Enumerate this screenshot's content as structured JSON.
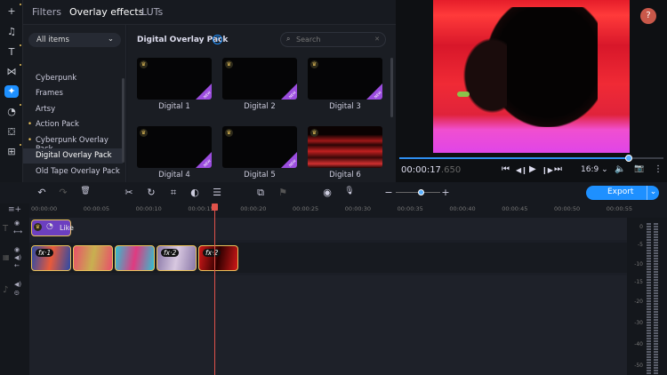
{
  "rail": {
    "icons": [
      "plus-icon",
      "music-icon",
      "text-icon",
      "transitions-icon",
      "effects-icon",
      "stickers-icon",
      "shop-icon",
      "more-apps-icon"
    ]
  },
  "tabs": [
    {
      "label": "Filters"
    },
    {
      "label": "Overlay effects",
      "active": true
    },
    {
      "label": "LUTs"
    }
  ],
  "category_select": {
    "value": "All items"
  },
  "categories": [
    {
      "label": "Cyberpunk"
    },
    {
      "label": "Frames"
    },
    {
      "label": "Artsy"
    },
    {
      "label": "Action Pack",
      "premium": true
    },
    {
      "label": "Cyberpunk Overlay Pack",
      "premium": true
    },
    {
      "label": "Digital Overlay Pack",
      "selected": true
    },
    {
      "label": "Old Tape Overlay Pack"
    }
  ],
  "pack": {
    "title": "Digital Overlay Pack",
    "help": "?",
    "search_placeholder": "Search",
    "clear": "✕"
  },
  "effects": [
    {
      "name": "Digital 1",
      "new": true
    },
    {
      "name": "Digital 2",
      "new": true
    },
    {
      "name": "Digital 3",
      "new": true
    },
    {
      "name": "Digital 4",
      "new": true
    },
    {
      "name": "Digital 5",
      "new": true
    },
    {
      "name": "Digital 6",
      "new": false
    }
  ],
  "badge_new": "NEW",
  "preview": {
    "help": "?",
    "time_main": "00:00:17",
    "time_ms": ".650",
    "progress": 0.87,
    "aspect": "16:9 ⌄"
  },
  "player": {
    "prev": "⏮",
    "step_back": "◀❙",
    "play": "▶",
    "step_fwd": "❙▶",
    "next": "⏭",
    "volume": "🔈",
    "snapshot": "📷",
    "more": "⋮"
  },
  "toolbar": {
    "undo": "↶",
    "redo": "↷",
    "delete": "🗑",
    "cut": "✂",
    "rotate": "↻",
    "crop": "⌗",
    "color": "◐",
    "adjust": "☰",
    "pip": "⧉",
    "marker": "⚑",
    "webcam": "◉",
    "mic": "🎙",
    "zoom_out": "−",
    "zoom_in": "+",
    "zoom_level": 0.45,
    "export": "Export",
    "export_more": "⌄"
  },
  "ruler": [
    "00:00:00",
    "00:00:05",
    "00:00:10",
    "00:00:15",
    "00:00:20",
    "00:00:25",
    "00:00:30",
    "00:00:35",
    "00:00:40",
    "00:00:45",
    "00:00:50",
    "00:00:55"
  ],
  "playhead_time": "00:00:17.650",
  "title_clip": {
    "label": "Like"
  },
  "video_clips": [
    {
      "fx": "fx·1",
      "colors": [
        "#2a4aa8",
        "#e85a3a"
      ]
    },
    {
      "fx": "",
      "colors": [
        "#e8506a",
        "#c8b050"
      ]
    },
    {
      "fx": "",
      "colors": [
        "#30c0d0",
        "#e03a80"
      ]
    },
    {
      "fx": "fx·2",
      "colors": [
        "#8a78a8",
        "#d8c8e0"
      ]
    },
    {
      "fx": "fx·2",
      "colors": [
        "#d01818",
        "#300000"
      ]
    }
  ],
  "meter": [
    "0",
    "-5",
    "-10",
    "-15",
    "-20",
    "-30",
    "-40",
    "-50"
  ],
  "colors": {
    "accent": "#1e90ff",
    "premium": "#e8c15a",
    "new_badge": "#9b4dde",
    "playhead": "#e0524a"
  }
}
